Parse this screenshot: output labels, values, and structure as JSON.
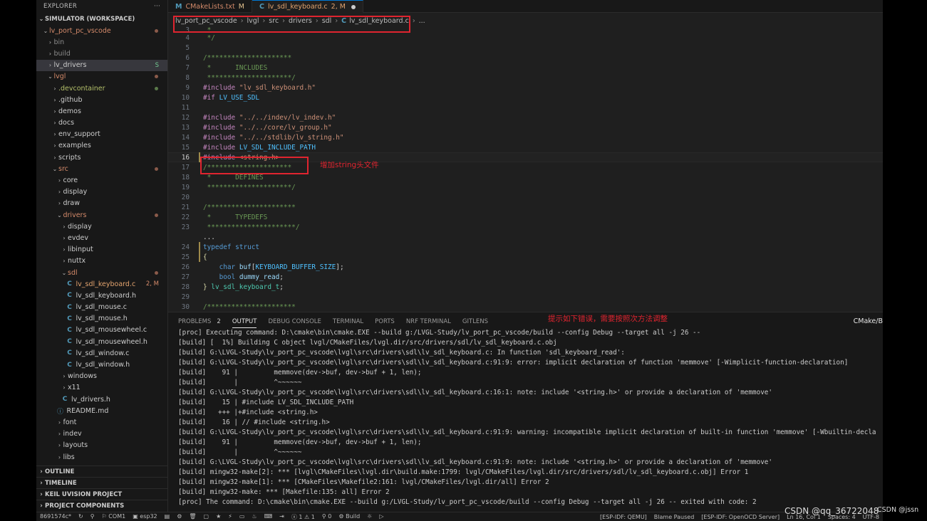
{
  "explorer": {
    "title": "EXPLORER",
    "more": "···",
    "workspace": "SIMULATOR (WORKSPACE)",
    "tree": [
      {
        "indent": 0,
        "chev": "⌄",
        "label": "lv_port_pc_vscode",
        "mod": true,
        "dot": true
      },
      {
        "indent": 1,
        "chev": "›",
        "label": "bin",
        "dim": true
      },
      {
        "indent": 1,
        "chev": "›",
        "label": "build",
        "dim": true
      },
      {
        "indent": 1,
        "chev": "›",
        "label": "lv_drivers",
        "sel": true,
        "badge": "S",
        "badgeColor": "#73c991"
      },
      {
        "indent": 1,
        "chev": "⌄",
        "label": "lvgl",
        "mod": true,
        "dot": true
      },
      {
        "indent": 2,
        "chev": "›",
        "label": ".devcontainer",
        "dot": true,
        "dotColor": "#5a7a4a",
        "green": true
      },
      {
        "indent": 2,
        "chev": "›",
        "label": ".github"
      },
      {
        "indent": 2,
        "chev": "›",
        "label": "demos"
      },
      {
        "indent": 2,
        "chev": "›",
        "label": "docs"
      },
      {
        "indent": 2,
        "chev": "›",
        "label": "env_support"
      },
      {
        "indent": 2,
        "chev": "›",
        "label": "examples"
      },
      {
        "indent": 2,
        "chev": "›",
        "label": "scripts"
      },
      {
        "indent": 2,
        "chev": "⌄",
        "label": "src",
        "mod": true,
        "dot": true
      },
      {
        "indent": 3,
        "chev": "›",
        "label": "core"
      },
      {
        "indent": 3,
        "chev": "›",
        "label": "display"
      },
      {
        "indent": 3,
        "chev": "›",
        "label": "draw"
      },
      {
        "indent": 3,
        "chev": "⌄",
        "label": "drivers",
        "mod": true,
        "dot": true
      },
      {
        "indent": 4,
        "chev": "›",
        "label": "display"
      },
      {
        "indent": 4,
        "chev": "›",
        "label": "evdev"
      },
      {
        "indent": 4,
        "chev": "›",
        "label": "libinput"
      },
      {
        "indent": 4,
        "chev": "›",
        "label": "nuttx"
      },
      {
        "indent": 4,
        "chev": "⌄",
        "label": "sdl",
        "mod": true,
        "dot": true
      },
      {
        "indent": 5,
        "icon": "C",
        "label": "lv_sdl_keyboard.c",
        "active": true,
        "badge": "2, M",
        "badgeColor": "#d48a6a"
      },
      {
        "indent": 5,
        "icon": "C",
        "label": "lv_sdl_keyboard.h"
      },
      {
        "indent": 5,
        "icon": "C",
        "label": "lv_sdl_mouse.c"
      },
      {
        "indent": 5,
        "icon": "C",
        "label": "lv_sdl_mouse.h"
      },
      {
        "indent": 5,
        "icon": "C",
        "label": "lv_sdl_mousewheel.c"
      },
      {
        "indent": 5,
        "icon": "C",
        "label": "lv_sdl_mousewheel.h"
      },
      {
        "indent": 5,
        "icon": "C",
        "label": "lv_sdl_window.c"
      },
      {
        "indent": 5,
        "icon": "C",
        "label": "lv_sdl_window.h"
      },
      {
        "indent": 4,
        "chev": "›",
        "label": "windows"
      },
      {
        "indent": 4,
        "chev": "›",
        "label": "x11"
      },
      {
        "indent": 4,
        "icon": "C",
        "label": "lv_drivers.h"
      },
      {
        "indent": 3,
        "icon": "ⓘ",
        "iconInfo": true,
        "label": "README.md"
      },
      {
        "indent": 3,
        "chev": "›",
        "label": "font"
      },
      {
        "indent": 3,
        "chev": "›",
        "label": "indev"
      },
      {
        "indent": 3,
        "chev": "›",
        "label": "layouts"
      },
      {
        "indent": 3,
        "chev": "›",
        "label": "libs"
      }
    ],
    "bottom_sections": [
      "OUTLINE",
      "TIMELINE",
      "KEIL UVISION PROJECT",
      "PROJECT COMPONENTS"
    ]
  },
  "tabs": [
    {
      "icon": "M",
      "iconColor": "#519aba",
      "label": "CMakeLists.txt",
      "status": "M",
      "active": false
    },
    {
      "icon": "C",
      "iconColor": "#519aba",
      "label": "lv_sdl_keyboard.c",
      "status": "2, M",
      "active": true
    }
  ],
  "breadcrumb": [
    "lv_port_pc_vscode",
    "lvgl",
    "src",
    "drivers",
    "sdl",
    "lv_sdl_keyboard.c",
    "..."
  ],
  "code": [
    {
      "n": "3",
      "t": [
        [
          "c-cm",
          " * "
        ]
      ]
    },
    {
      "n": "4",
      "t": [
        [
          "c-cm",
          " */"
        ]
      ]
    },
    {
      "n": "5",
      "t": []
    },
    {
      "n": "6",
      "t": [
        [
          "c-cm",
          "/*********************"
        ]
      ]
    },
    {
      "n": "7",
      "t": [
        [
          "c-cm",
          " *      INCLUDES"
        ]
      ]
    },
    {
      "n": "8",
      "t": [
        [
          "c-cm",
          " *********************/"
        ]
      ]
    },
    {
      "n": "9",
      "t": [
        [
          "c-pp",
          "#include "
        ],
        [
          "c-str",
          "\"lv_sdl_keyboard.h\""
        ]
      ]
    },
    {
      "n": "10",
      "t": [
        [
          "c-pp",
          "#if "
        ],
        [
          "c-mac",
          "LV_USE_SDL"
        ]
      ]
    },
    {
      "n": "11",
      "t": []
    },
    {
      "n": "12",
      "t": [
        [
          "c-pp",
          "#include "
        ],
        [
          "c-str",
          "\"../../indev/lv_indev.h\""
        ]
      ]
    },
    {
      "n": "13",
      "t": [
        [
          "c-pp",
          "#include "
        ],
        [
          "c-str",
          "\"../../core/lv_group.h\""
        ]
      ]
    },
    {
      "n": "14",
      "t": [
        [
          "c-pp",
          "#include "
        ],
        [
          "c-str",
          "\"../../stdlib/lv_string.h\""
        ]
      ]
    },
    {
      "n": "15",
      "t": [
        [
          "c-pp",
          "#include "
        ],
        [
          "c-mac",
          "LV_SDL_INCLUDE_PATH"
        ]
      ]
    },
    {
      "n": "16",
      "cur": true,
      "mark": true,
      "t": [
        [
          "c-pp",
          "#include "
        ],
        [
          "c-str",
          "<string.h>"
        ]
      ]
    },
    {
      "n": "17",
      "t": [
        [
          "c-cm",
          "/*********************"
        ]
      ]
    },
    {
      "n": "18",
      "t": [
        [
          "c-cm",
          " *      DEFINES"
        ]
      ]
    },
    {
      "n": "19",
      "t": [
        [
          "c-cm",
          " *********************/"
        ]
      ]
    },
    {
      "n": "20",
      "t": []
    },
    {
      "n": "21",
      "t": [
        [
          "c-cm",
          "/**********************"
        ]
      ]
    },
    {
      "n": "22",
      "t": [
        [
          "c-cm",
          " *      TYPEDEFS"
        ]
      ]
    },
    {
      "n": "23",
      "t": [
        [
          "c-cm",
          " **********************/"
        ]
      ]
    },
    {
      "n": "",
      "t": [
        [
          "c-pl",
          "..."
        ]
      ]
    },
    {
      "n": "24",
      "mark": true,
      "t": [
        [
          "c-kw",
          "typedef "
        ],
        [
          "c-kw",
          "struct"
        ]
      ]
    },
    {
      "n": "25",
      "mark": true,
      "t": [
        [
          "c-fn",
          "{"
        ]
      ]
    },
    {
      "n": "26",
      "t": [
        [
          "c-pl",
          "    "
        ],
        [
          "c-kw",
          "char "
        ],
        [
          "c-id",
          "buf"
        ],
        [
          "c-pl",
          "["
        ],
        [
          "c-mac",
          "KEYBOARD_BUFFER_SIZE"
        ],
        [
          "c-pl",
          "];"
        ]
      ]
    },
    {
      "n": "27",
      "t": [
        [
          "c-pl",
          "    "
        ],
        [
          "c-kw",
          "bool "
        ],
        [
          "c-id",
          "dummy_read"
        ],
        [
          "c-pl",
          ";"
        ]
      ]
    },
    {
      "n": "28",
      "t": [
        [
          "c-fn",
          "} "
        ],
        [
          "c-ty",
          "lv_sdl_keyboard_t"
        ],
        [
          "c-pl",
          ";"
        ]
      ]
    },
    {
      "n": "29",
      "t": []
    },
    {
      "n": "30",
      "t": [
        [
          "c-cm",
          "/**********************"
        ]
      ]
    }
  ],
  "annotations": {
    "code_note": "增加string头文件",
    "panel_note": "提示如下错误，需要按照次方法调整"
  },
  "panel": {
    "tabs": [
      {
        "label": "PROBLEMS",
        "count": "2"
      },
      {
        "label": "OUTPUT",
        "active": true
      },
      {
        "label": "DEBUG CONSOLE"
      },
      {
        "label": "TERMINAL"
      },
      {
        "label": "PORTS"
      },
      {
        "label": "NRF TERMINAL"
      },
      {
        "label": "GITLENS"
      }
    ],
    "right_label": "CMake/B",
    "lines": [
      "[proc] Executing command: D:\\cmake\\bin\\cmake.EXE --build g:/LVGL-Study/lv_port_pc_vscode/build --config Debug --target all -j 26 --",
      "[build] [  1%] Building C object lvgl/CMakeFiles/lvgl.dir/src/drivers/sdl/lv_sdl_keyboard.c.obj",
      "[build] G:\\LVGL-Study\\lv_port_pc_vscode\\lvgl\\src\\drivers\\sdl\\lv_sdl_keyboard.c: In function 'sdl_keyboard_read':",
      "[build] G:\\LVGL-Study\\lv_port_pc_vscode\\lvgl\\src\\drivers\\sdl\\lv_sdl_keyboard.c:91:9: error: implicit declaration of function 'memmove' [-Wimplicit-function-declaration]",
      "[build]    91 |         memmove(dev->buf, dev->buf + 1, len);",
      "[build]       |         ^~~~~~~",
      "[build] G:\\LVGL-Study\\lv_port_pc_vscode\\lvgl\\src\\drivers\\sdl\\lv_sdl_keyboard.c:16:1: note: include '<string.h>' or provide a declaration of 'memmove'",
      "[build]    15 | #include LV_SDL_INCLUDE_PATH",
      "[build]   +++ |+#include <string.h>",
      "[build]    16 | // #include <string.h>",
      "[build] G:\\LVGL-Study\\lv_port_pc_vscode\\lvgl\\src\\drivers\\sdl\\lv_sdl_keyboard.c:91:9: warning: incompatible implicit declaration of built-in function 'memmove' [-Wbuiltin-decla",
      "[build]    91 |         memmove(dev->buf, dev->buf + 1, len);",
      "[build]       |         ^~~~~~~",
      "[build] G:\\LVGL-Study\\lv_port_pc_vscode\\lvgl\\src\\drivers\\sdl\\lv_sdl_keyboard.c:91:9: note: include '<string.h>' or provide a declaration of 'memmove'",
      "[build] mingw32-make[2]: *** [lvgl\\CMakeFiles\\lvgl.dir\\build.make:1799: lvgl/CMakeFiles/lvgl.dir/src/drivers/sdl/lv_sdl_keyboard.c.obj] Error 1",
      "[build] mingw32-make[1]: *** [CMakeFiles\\Makefile2:161: lvgl/CMakeFiles/lvgl.dir/all] Error 2",
      "[build] mingw32-make: *** [Makefile:135: all] Error 2",
      "[proc] The command: D:\\cmake\\bin\\cmake.EXE --build g:/LVGL-Study/lv_port_pc_vscode/build --config Debug --target all -j 26 -- exited with code: 2"
    ]
  },
  "statusbar": {
    "left": [
      "8691574c*",
      "↻",
      "⚲",
      "⚐ COM1",
      "▣ esp32",
      "▤",
      "⚙",
      "🗑",
      "▢",
      "★",
      "⚡",
      "▭",
      "♨",
      "⌨",
      "⇥",
      "ⓧ 1 ⚠ 1",
      "⚲ 0",
      "⚙ Build",
      "☼",
      "▷"
    ],
    "right": [
      "[ESP-IDF: QEMU]",
      "Blame Paused",
      "[ESP-IDF: OpenOCD Server]",
      "Ln 16, Col 1",
      "Spaces: 4",
      "UTF-8"
    ]
  },
  "watermark": "CSDN @qq_36722048",
  "watermark2": "CSDN @jssn"
}
